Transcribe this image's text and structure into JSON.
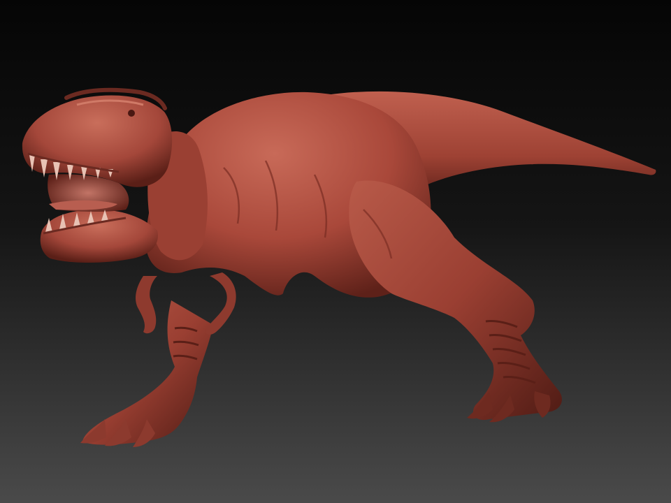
{
  "scene": {
    "subject": "tyrannosaurus-sculpt",
    "colors": {
      "background_top": "#050505",
      "background_bottom": "#4a4a4a",
      "clay_base": "#a9483a",
      "clay_light": "#c86a58",
      "clay_dark": "#5e2119",
      "clay_shadow": "#3d1510",
      "teeth": "#e8c2b4",
      "mouth_inner": "#7a2a22"
    }
  }
}
